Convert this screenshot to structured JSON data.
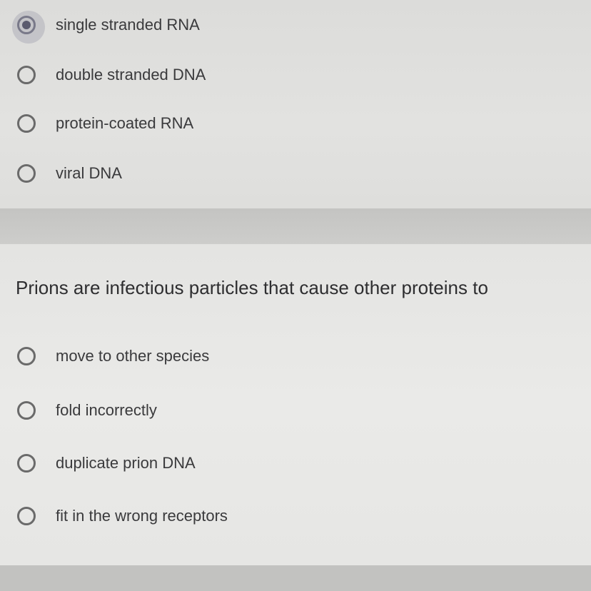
{
  "question1": {
    "options": [
      {
        "label": "single stranded RNA",
        "selected": true
      },
      {
        "label": "double stranded DNA",
        "selected": false
      },
      {
        "label": "protein-coated RNA",
        "selected": false
      },
      {
        "label": "viral DNA",
        "selected": false
      }
    ]
  },
  "question2": {
    "text": "Prions are infectious particles that cause other proteins to",
    "options": [
      {
        "label": "move to other species",
        "selected": false
      },
      {
        "label": "fold incorrectly",
        "selected": false
      },
      {
        "label": "duplicate prion DNA",
        "selected": false
      },
      {
        "label": "fit in the wrong receptors",
        "selected": false
      }
    ]
  },
  "colors": {
    "card_background": "#e6e6e4",
    "separator": "#c9c9c7",
    "radio_border": "#6a6a6a",
    "radio_selected": "#5b5b6e",
    "text": "#3a3a3c"
  }
}
